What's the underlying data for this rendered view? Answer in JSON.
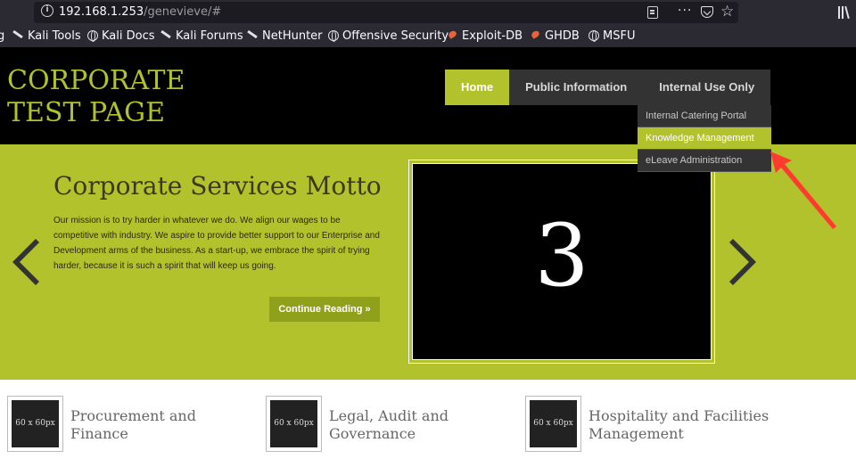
{
  "browser": {
    "url_host": "192.168.1.253",
    "url_path": "/genevieve/#",
    "more_glyph": "···",
    "star_glyph": "☆",
    "bookmarks": [
      {
        "label": "Kali Tools",
        "icon": "kali-dragon-icon"
      },
      {
        "label": "Kali Docs",
        "icon": "globe-icon"
      },
      {
        "label": "Kali Forums",
        "icon": "kali-dragon-icon"
      },
      {
        "label": "NetHunter",
        "icon": "kali-dragon-icon"
      },
      {
        "label": "Offensive Security",
        "icon": "globe-icon"
      },
      {
        "label": "Exploit-DB",
        "icon": "exploit-db-icon"
      },
      {
        "label": "GHDB",
        "icon": "exploit-db-icon"
      },
      {
        "label": "MSFU",
        "icon": "globe-icon"
      }
    ],
    "bookmark_fragment": "g"
  },
  "site": {
    "logo_line1": "CORPORATE",
    "logo_line2": "TEST PAGE",
    "nav": [
      {
        "label": "Home",
        "active": true
      },
      {
        "label": "Public Information",
        "active": false
      },
      {
        "label": "Internal Use Only",
        "active": false
      }
    ],
    "dropdown": [
      {
        "label": "Internal Catering Portal",
        "active": false
      },
      {
        "label": "Knowledge Management",
        "active": true
      },
      {
        "label": "eLeave Administration",
        "active": false
      }
    ]
  },
  "hero": {
    "title": "Corporate Services Motto",
    "body": "Our mission is to try harder in whatever we do. We align our wages to be competitive with industry. We aspire to provide better support to our Enterprise and Development arms of the business. As a start-up, we embrace the spirit of trying harder, because it is such a spirit that will keep us going.",
    "cta": "Continue Reading »",
    "slide_number": "3"
  },
  "features": [
    {
      "thumb": "60 x 60px",
      "title": "Procurement and Finance"
    },
    {
      "thumb": "60 x 60px",
      "title": "Legal, Audit and Governance"
    },
    {
      "thumb": "60 x 60px",
      "title": "Hospitality and Facilities Management"
    }
  ],
  "colors": {
    "accent": "#b2c22c",
    "header_bg": "#000000",
    "nav_bg": "#333333",
    "annotation_arrow": "#ff3b30"
  }
}
